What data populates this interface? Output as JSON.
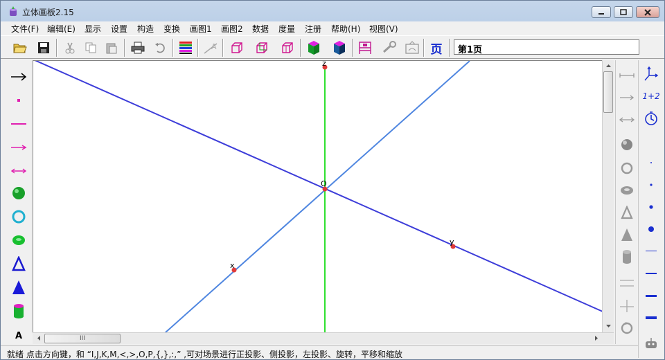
{
  "window": {
    "title": "立体画板2.15"
  },
  "menu": [
    "文件(F)",
    "编辑(E)",
    "显示",
    "设置",
    "构造",
    "变换",
    "画图1",
    "画图2",
    "数据",
    "度量",
    "注册",
    "帮助(H)",
    "视图(V)"
  ],
  "toolbar": {
    "page_label": "第1页",
    "page_icon_text": "页",
    "icons": [
      "open-folder",
      "save",
      "cut",
      "copy",
      "paste",
      "print",
      "undo",
      "color-palette",
      "text-style",
      "cube-1",
      "cube-2",
      "cube-3",
      "hexagonal-prism",
      "hexagonal-prism-dark",
      "coordinate-system",
      "wrench",
      "picture",
      "page"
    ]
  },
  "left_tools": [
    "arrow",
    "point",
    "segment",
    "ray",
    "line",
    "sphere",
    "circle",
    "ellipse",
    "triangle-outline",
    "cone",
    "cylinder",
    "text"
  ],
  "left_text_tool_label": "A",
  "canvas": {
    "point_labels": {
      "z": "z",
      "origin": "O",
      "x": "x",
      "y": "y"
    },
    "colors": {
      "axis_lines": "#3d3dd9",
      "axis_light": "#4f86e0",
      "z_axis": "#2fe02f",
      "point": "#e03a3a"
    }
  },
  "right_tools": [
    "segment",
    "ray",
    "line",
    "sphere",
    "circle",
    "ellipse",
    "triangle-outline",
    "cone",
    "cylinder",
    "parallel-lines",
    "perpendicular",
    "rotate-circle"
  ],
  "far_tools": {
    "axes_label": "3D axes",
    "num_label": "1+2",
    "clock_label": "timer",
    "dot_sizes": [
      "1",
      "2",
      "3",
      "4"
    ],
    "line_weights": [
      "1",
      "2",
      "3",
      "4"
    ]
  },
  "scrollbars": {
    "h_thumb_grip": "III"
  },
  "status": {
    "text": "就绪 点击方向键，和 “I,J,K,M,<,>,O,P,{,},:,” ,可对场景进行正投影、侧投影，左投影、旋转，平移和缩放"
  }
}
